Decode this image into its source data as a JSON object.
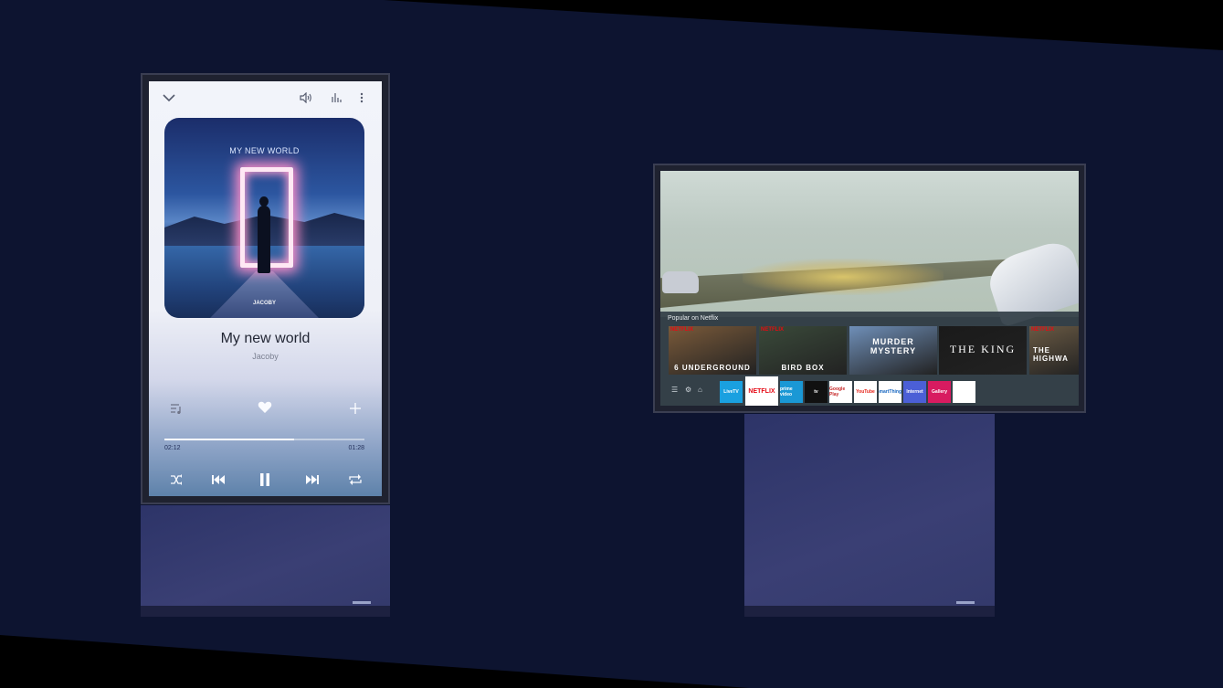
{
  "portrait_player": {
    "album_art_title": "MY NEW WORLD",
    "album_art_artist": "JACOBY",
    "song_title": "My new world",
    "artist": "Jacoby",
    "elapsed": "02:12",
    "remaining": "01:28",
    "progress": 0.65,
    "favorite": true
  },
  "netflix": {
    "row_title": "Popular on Netflix",
    "badge": "NETFLIX",
    "posters": [
      {
        "title": "6 UNDERGROUND",
        "color": "#7a5a3a"
      },
      {
        "title": "BIRD BOX",
        "color": "#3a4a3a"
      },
      {
        "title": "MURDER MYSTERY",
        "color": "#6f8fb8"
      },
      {
        "title": "THE KING",
        "color": "#1a1a1a"
      },
      {
        "title": "THE HIGHWA",
        "color": "#6a5a44"
      }
    ]
  },
  "app_bar": {
    "apps": [
      {
        "label": "LiveTV",
        "bg": "#1aa0e0",
        "fg": "#ffffff"
      },
      {
        "label": "NETFLIX",
        "bg": "#ffffff",
        "fg": "#e50914"
      },
      {
        "label": "prime video",
        "bg": "#1a98d5",
        "fg": "#ffffff"
      },
      {
        "label": "tv",
        "bg": "#111111",
        "fg": "#ffffff"
      },
      {
        "label": "Google Play",
        "bg": "#ffffff",
        "fg": "#c62828"
      },
      {
        "label": "YouTube",
        "bg": "#ffffff",
        "fg": "#e62117"
      },
      {
        "label": "SmartThings",
        "bg": "#ffffff",
        "fg": "#1565c0"
      },
      {
        "label": "Internet",
        "bg": "#4b5fd6",
        "fg": "#ffffff"
      },
      {
        "label": "Gallery",
        "bg": "#d81b60",
        "fg": "#ffffff"
      },
      {
        "label": "",
        "bg": "#ffffff",
        "fg": "#1b8a6b"
      }
    ]
  }
}
